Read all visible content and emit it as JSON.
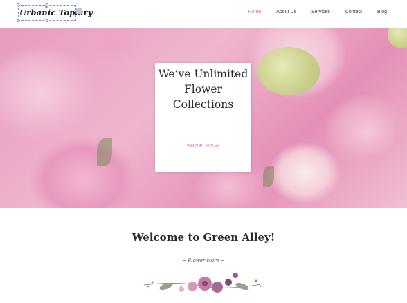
{
  "brand": {
    "logo_text": "Urbanic Topiary"
  },
  "nav": {
    "items": [
      "Home",
      "About Us",
      "Services",
      "Contact",
      "Blog"
    ],
    "active": "Home",
    "active_color": "#e56aa8"
  },
  "hero": {
    "title": "We’ve Unlimited Flower Collections",
    "button_label": "SHOP NOW",
    "accent_color": "#e36ea8"
  },
  "intro": {
    "heading": "Welcome to Green Alley!",
    "subtitle": "~ Flower store ~"
  },
  "icons": {
    "logo_edit": "edit-handle-icon",
    "floral_divider": "floral-divider-icon"
  }
}
